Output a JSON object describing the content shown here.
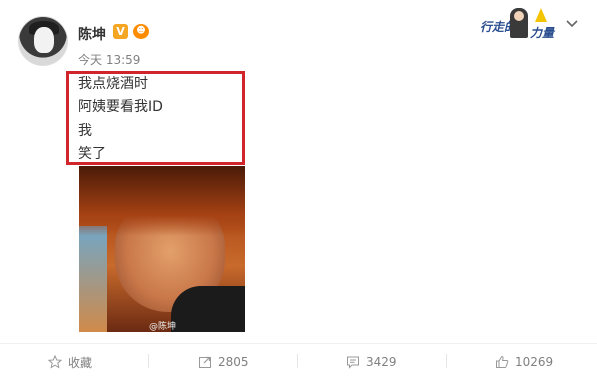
{
  "post": {
    "user_name": "陈坤",
    "verified_label": "V",
    "vip_label": "☻",
    "time": "今天 13:59",
    "lines": [
      "我点烧酒时",
      "阿姨要看我ID",
      "我",
      "笑了"
    ],
    "image_watermark": "@陈坤"
  },
  "campaign": {
    "text_a": "行走的",
    "text_b": "力量"
  },
  "actions": {
    "favorite_label": "收藏",
    "repost_count": "2805",
    "comment_count": "3429",
    "like_count": "10269"
  },
  "colors": {
    "highlight_border": "#d0252b",
    "verified": "#f5a623",
    "muted_text": "#808080"
  },
  "icons": [
    "star-icon",
    "repost-icon",
    "comment-icon",
    "thumbs-up-icon",
    "chevron-down-icon",
    "verified-icon",
    "vip-icon"
  ]
}
